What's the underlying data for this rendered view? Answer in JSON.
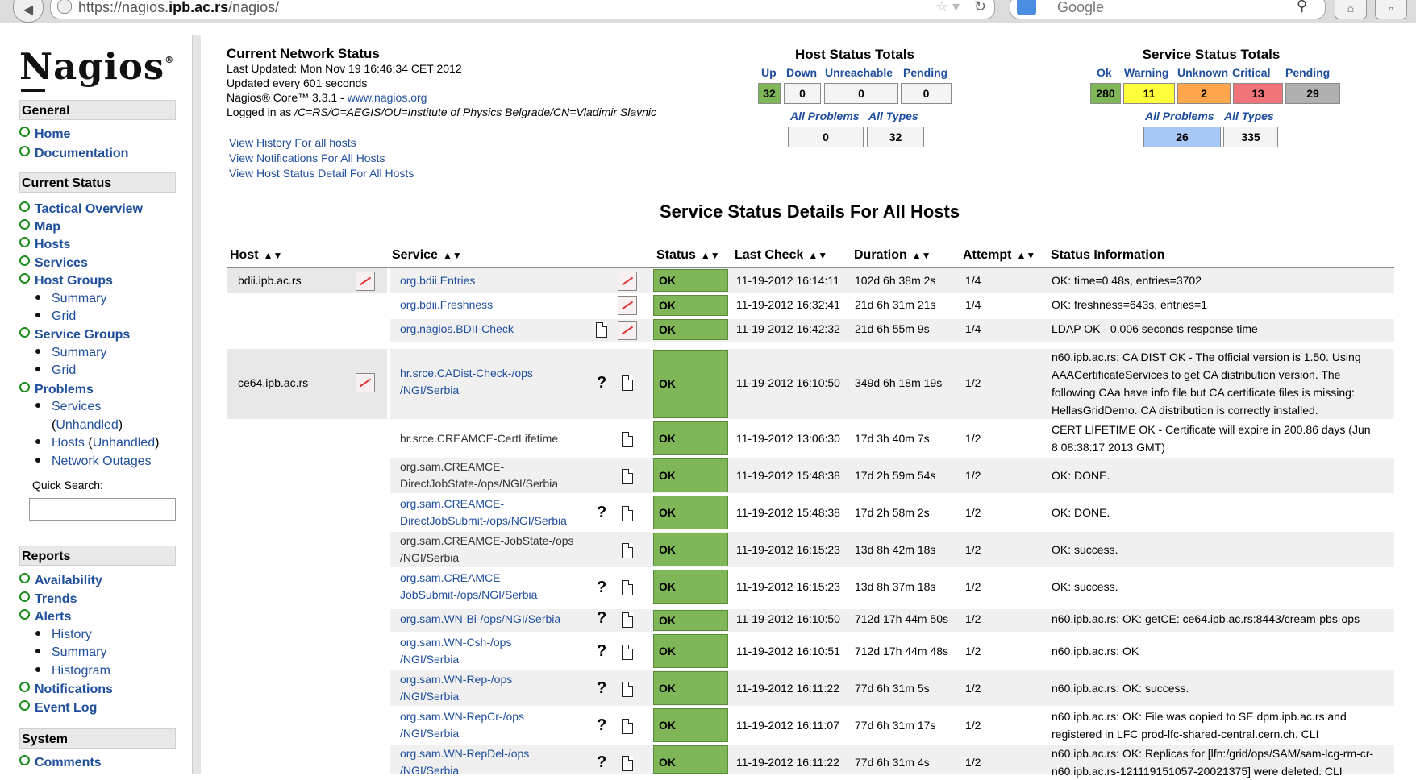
{
  "browser": {
    "url_proto": "https://nagios.",
    "url_host": "ipb.ac.rs",
    "url_path": "/nagios/",
    "search_text": "Google"
  },
  "sidebar": {
    "logo": "Nagios",
    "logo_mark": "®",
    "general_label": "General",
    "home": "Home",
    "documentation": "Documentation",
    "current_status_label": "Current Status",
    "tactical_overview": "Tactical Overview",
    "map": "Map",
    "hosts": "Hosts",
    "services": "Services",
    "host_groups": "Host Groups",
    "hg_summary": "Summary",
    "hg_grid": "Grid",
    "service_groups": "Service Groups",
    "sg_summary": "Summary",
    "sg_grid": "Grid",
    "problems": "Problems",
    "pr_services": "Services",
    "pr_unhandled": "Unhandled",
    "pr_hosts": "Hosts",
    "pr_hosts_unhandled": "Unhandled",
    "pr_network_outages": "Network Outages",
    "quick_search": "Quick Search:",
    "reports_label": "Reports",
    "availability": "Availability",
    "trends": "Trends",
    "alerts": "Alerts",
    "al_history": "History",
    "al_summary": "Summary",
    "al_histogram": "Histogram",
    "notifications": "Notifications",
    "event_log": "Event Log",
    "system_label": "System",
    "comments": "Comments"
  },
  "header": {
    "title": "Current Network Status",
    "last_updated": "Last Updated: Mon Nov 19 16:46:34 CET 2012",
    "update_interval": "Updated every 601 seconds",
    "core_version_prefix": "Nagios® Core™ 3.3.1 - ",
    "core_link": "www.nagios.org",
    "logged_in_prefix": "Logged in as ",
    "logged_in_user": "/C=RS/O=AEGIS/OU=Institute of Physics Belgrade/CN=Vladimir Slavnic",
    "link_history": "View History For all hosts",
    "link_notifications": "View Notifications For All Hosts",
    "link_host_detail": "View Host Status Detail For All Hosts"
  },
  "host_totals": {
    "title": "Host Status Totals",
    "up_label": "Up",
    "down_label": "Down",
    "unreachable_label": "Unreachable",
    "pending_label": "Pending",
    "up": "32",
    "down": "0",
    "unreachable": "0",
    "pending": "0",
    "all_problems_label": "All Problems",
    "all_types_label": "All Types",
    "all_problems": "0",
    "all_types": "32"
  },
  "service_totals": {
    "title": "Service Status Totals",
    "ok_label": "Ok",
    "warning_label": "Warning",
    "unknown_label": "Unknown",
    "critical_label": "Critical",
    "pending_label": "Pending",
    "ok": "280",
    "warning": "11",
    "unknown": "2",
    "critical": "13",
    "pending": "29",
    "all_problems_label": "All Problems",
    "all_types_label": "All Types",
    "all_problems": "26",
    "all_types": "335"
  },
  "colors": {
    "ok_green": "#7fb657",
    "warning_yellow": "#ffff3b",
    "unknown_orange": "#ffa64d",
    "critical_red": "#f0747a",
    "pending_gray": "#b0b0b0",
    "problems_blue": "#a8c8f8"
  },
  "main_title": "Service Status Details For All Hosts",
  "columns": {
    "host": "Host",
    "service": "Service",
    "status": "Status",
    "last_check": "Last Check",
    "duration": "Duration",
    "attempt": "Attempt",
    "status_information": "Status Information"
  },
  "rows": [
    {
      "host": "bdii.ipb.ac.rs",
      "service": [
        "org.bdii.Entries"
      ],
      "status": "OK",
      "last_check": "11-19-2012 16:14:11",
      "duration": "102d 6h 38m 2s",
      "attempt": "1/4",
      "info": [
        "OK: time=0.48s, entries=3702"
      ]
    },
    {
      "host": "",
      "service": [
        "org.bdii.Freshness"
      ],
      "status": "OK",
      "last_check": "11-19-2012 16:32:41",
      "duration": "21d 6h 31m 21s",
      "attempt": "1/4",
      "info": [
        "OK: freshness=643s, entries=1"
      ]
    },
    {
      "host": "",
      "service": [
        "org.nagios.BDII-Check"
      ],
      "status": "OK",
      "last_check": "11-19-2012 16:42:32",
      "duration": "21d 6h 55m 9s",
      "attempt": "1/4",
      "info": [
        "LDAP OK - 0.006 seconds response time"
      ]
    },
    {
      "host": "ce64.ipb.ac.rs",
      "service": [
        "hr.srce.CADist-Check-/ops",
        "/NGI/Serbia"
      ],
      "status": "OK",
      "last_check": "11-19-2012 16:10:50",
      "duration": "349d 6h 18m 19s",
      "attempt": "1/2",
      "info": [
        "n60.ipb.ac.rs: CA DIST OK - The official version is 1.50. Using",
        "AAACertificateServices to get CA distribution version. The",
        "following CAa have info file but CA certificate files is missing:",
        "HellasGridDemo. CA distribution is correctly installed."
      ]
    },
    {
      "host": "",
      "service": [
        "hr.srce.CREAMCE-CertLifetime"
      ],
      "status": "OK",
      "last_check": "11-19-2012 13:06:30",
      "duration": "17d 3h 40m 7s",
      "attempt": "1/2",
      "info": [
        "CERT LIFETIME OK - Certificate will expire in 200.86 days (Jun",
        "8 08:38:17 2013 GMT)"
      ]
    },
    {
      "host": "",
      "service": [
        "org.sam.CREAMCE-",
        "DirectJobState-/ops/NGI/Serbia"
      ],
      "status": "OK",
      "last_check": "11-19-2012 15:48:38",
      "duration": "17d 2h 59m 54s",
      "attempt": "1/2",
      "info": [
        "OK: DONE."
      ]
    },
    {
      "host": "",
      "service": [
        "org.sam.CREAMCE-",
        "DirectJobSubmit-/ops/NGI/Serbia"
      ],
      "status": "OK",
      "last_check": "11-19-2012 15:48:38",
      "duration": "17d 2h 58m 2s",
      "attempt": "1/2",
      "info": [
        "OK: DONE."
      ]
    },
    {
      "host": "",
      "service": [
        "org.sam.CREAMCE-JobState-/ops",
        "/NGI/Serbia"
      ],
      "status": "OK",
      "last_check": "11-19-2012 16:15:23",
      "duration": "13d 8h 42m 18s",
      "attempt": "1/2",
      "info": [
        "OK: success."
      ]
    },
    {
      "host": "",
      "service": [
        "org.sam.CREAMCE-",
        "JobSubmit-/ops/NGI/Serbia"
      ],
      "status": "OK",
      "last_check": "11-19-2012 16:15:23",
      "duration": "13d 8h 37m 18s",
      "attempt": "1/2",
      "info": [
        "OK: success."
      ]
    },
    {
      "host": "",
      "service": [
        "org.sam.WN-Bi-/ops/NGI/Serbia"
      ],
      "status": "OK",
      "last_check": "11-19-2012 16:10:50",
      "duration": "712d 17h 44m 50s",
      "attempt": "1/2",
      "info": [
        "n60.ipb.ac.rs: OK: getCE: ce64.ipb.ac.rs:8443/cream-pbs-ops"
      ]
    },
    {
      "host": "",
      "service": [
        "org.sam.WN-Csh-/ops",
        "/NGI/Serbia"
      ],
      "status": "OK",
      "last_check": "11-19-2012 16:10:51",
      "duration": "712d 17h 44m 48s",
      "attempt": "1/2",
      "info": [
        "n60.ipb.ac.rs: OK"
      ]
    },
    {
      "host": "",
      "service": [
        "org.sam.WN-Rep-/ops",
        "/NGI/Serbia"
      ],
      "status": "OK",
      "last_check": "11-19-2012 16:11:22",
      "duration": "77d 6h 31m 5s",
      "attempt": "1/2",
      "info": [
        "n60.ipb.ac.rs: OK: success."
      ]
    },
    {
      "host": "",
      "service": [
        "org.sam.WN-RepCr-/ops",
        "/NGI/Serbia"
      ],
      "status": "OK",
      "last_check": "11-19-2012 16:11:07",
      "duration": "77d 6h 31m 17s",
      "attempt": "1/2",
      "info": [
        "n60.ipb.ac.rs: OK: File was copied to SE dpm.ipb.ac.rs and",
        "registered in LFC prod-lfc-shared-central.cern.ch. CLI"
      ]
    },
    {
      "host": "",
      "service": [
        "org.sam.WN-RepDel-/ops",
        "/NGI/Serbia"
      ],
      "status": "OK",
      "last_check": "11-19-2012 16:11:22",
      "duration": "77d 6h 31m 4s",
      "attempt": "1/2",
      "info": [
        "n60.ipb.ac.rs: OK: Replicas for [lfn:/grid/ops/SAM/sam-lcg-rm-cr-",
        "n60.ipb.ac.rs-121119151057-20021375] were deleted. CLI"
      ]
    }
  ]
}
